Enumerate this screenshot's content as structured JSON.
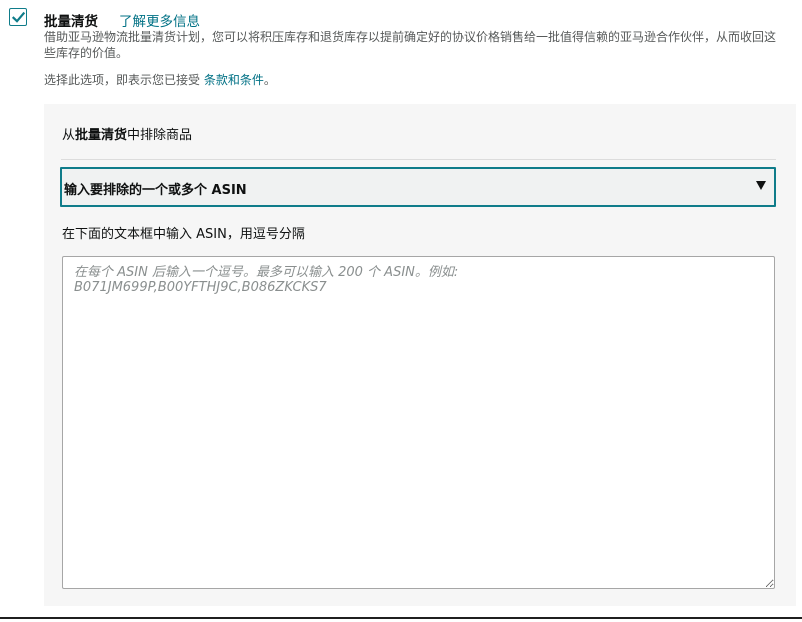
{
  "option": {
    "checked": true,
    "title": "批量清货",
    "learn_more": "了解更多信息",
    "description": "借助亚马逊物流批量清货计划，您可以将积压库存和退货库存以提前确定好的协议价格销售给一批值得信赖的亚马逊合作伙伴，从而收回这些库存的价值。",
    "accept_prefix": "选择此选项，即表示您已接受",
    "terms_link": "条款和条件",
    "accept_suffix": "。"
  },
  "exclusion": {
    "heading_prefix": "从",
    "heading_bold": "批量清货",
    "heading_suffix": "中排除商品",
    "select_value": "输入要排除的一个或多个 ASIN",
    "instruction": "在下面的文本框中输入 ASIN，用逗号分隔",
    "textarea_value": "",
    "textarea_placeholder": "在每个 ASIN 后输入一个逗号。最多可以输入 200 个 ASIN。例如:\nB071JM699P,B00YFTHJ9C,B086ZKCKS7"
  },
  "colors": {
    "accent": "#0f7c8a",
    "link": "#007185",
    "panel_bg": "#f6f6f6"
  }
}
